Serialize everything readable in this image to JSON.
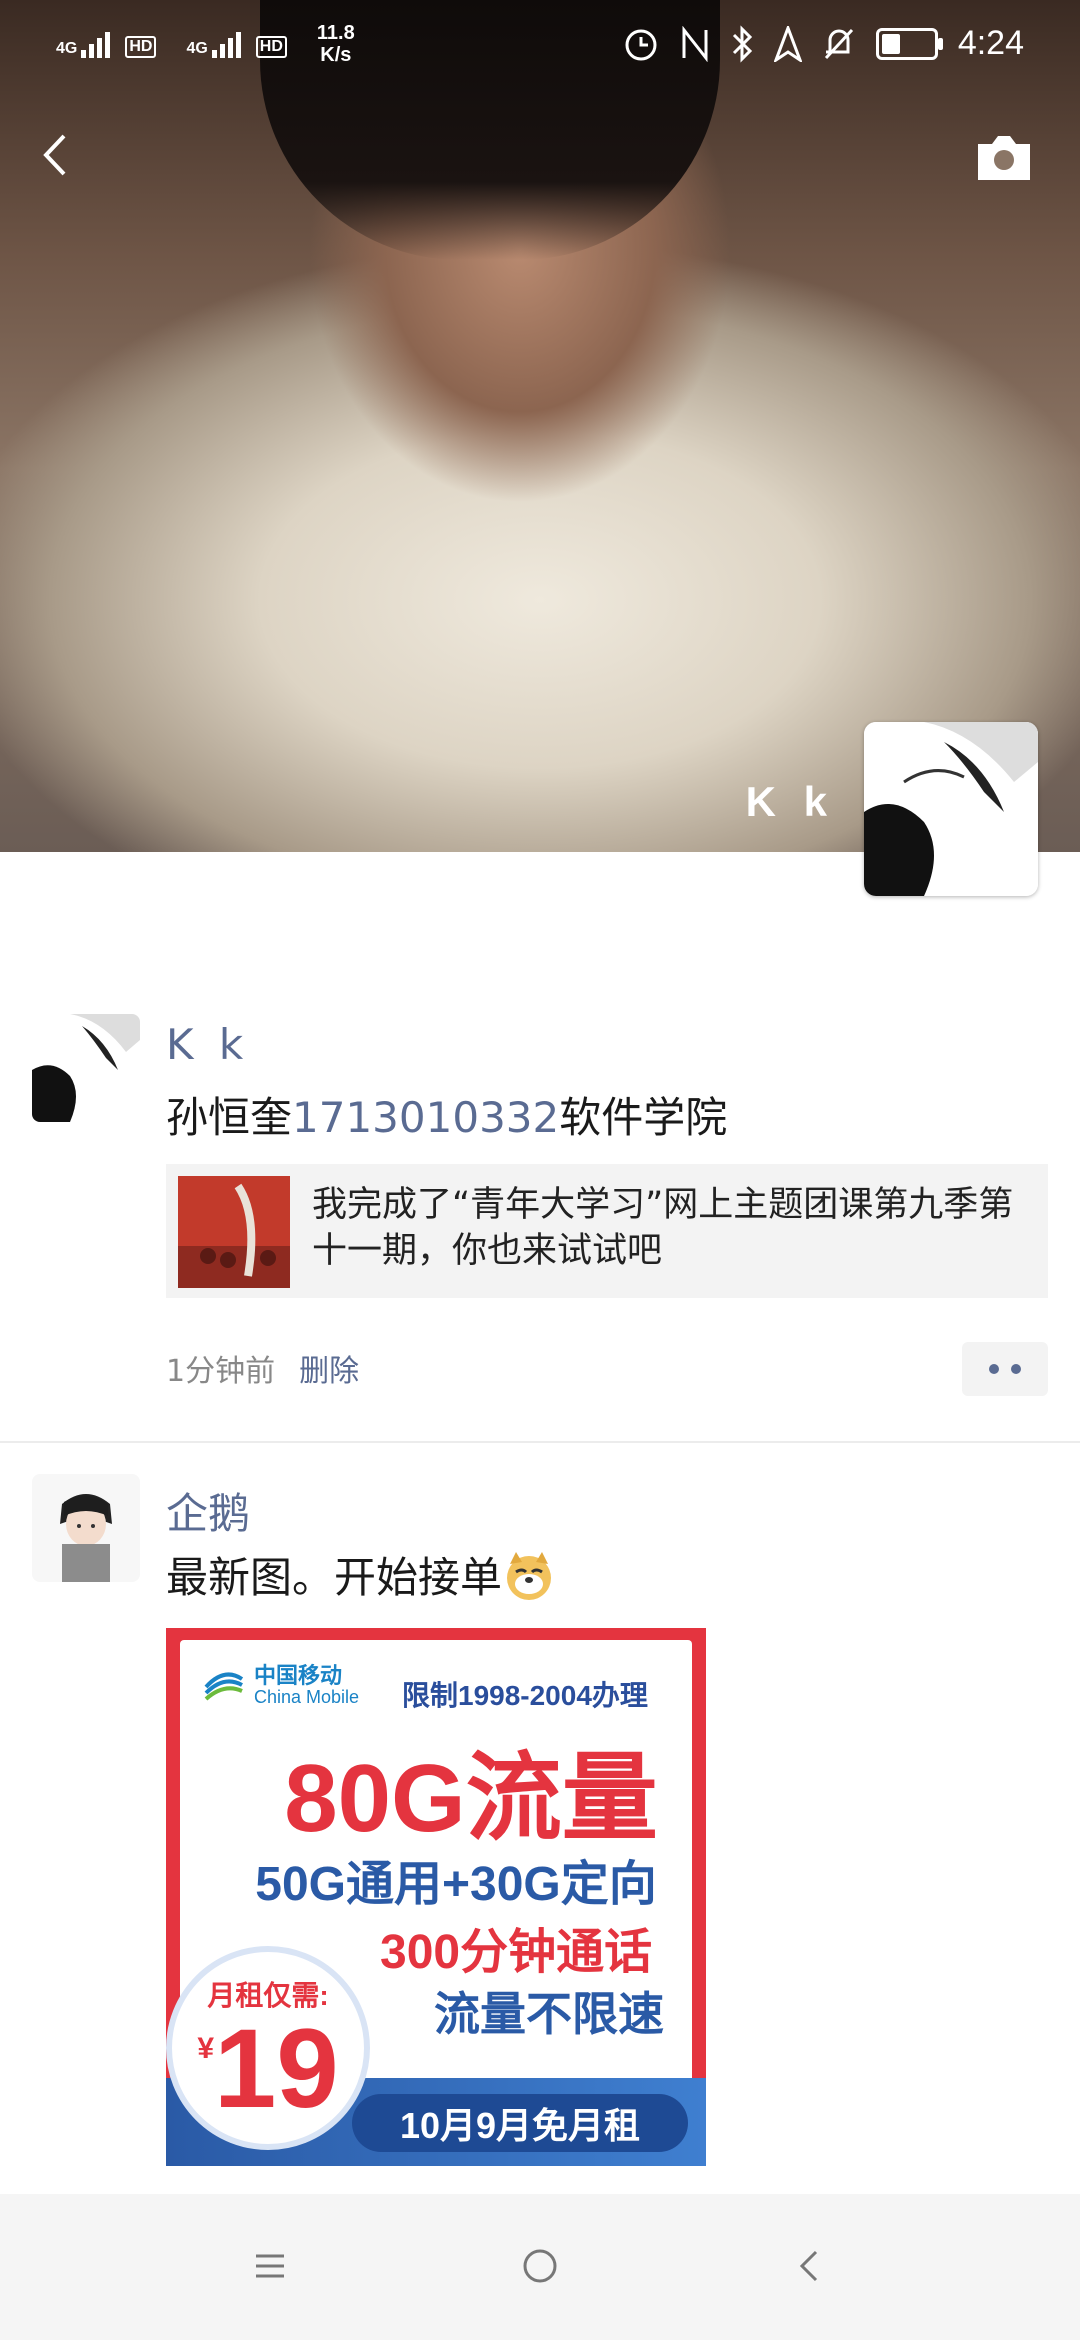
{
  "status_bar": {
    "network1": "4G",
    "hd1": "HD",
    "network2": "4G",
    "hd2": "HD",
    "speed_value": "11.8",
    "speed_unit": "K/s",
    "time": "4:24",
    "icons": [
      "alarm-icon",
      "nfc-icon",
      "bluetooth-icon",
      "location-icon",
      "mute-icon",
      "battery-icon"
    ]
  },
  "cover": {
    "name": "K k",
    "icons": [
      "back-arrow-icon",
      "camera-icon"
    ]
  },
  "posts": [
    {
      "name": "K k",
      "text_prefix": "孙恒奎",
      "text_number": "1713010332",
      "text_suffix": "软件学院",
      "share_title": "我完成了“青年大学习”网上主题团课第九季第十一期，你也来试试吧",
      "time_ago": "1分钟前",
      "delete_label": "删除"
    },
    {
      "name": "企鹅",
      "text": "最新图。开始接单",
      "ad": {
        "logo_zh": "中国移动",
        "logo_en": "China Mobile",
        "limit": "限制1998-2004办理",
        "headline": "80G流量",
        "line2": "50G通用+30G定向",
        "line3": "300分钟通话",
        "line4": "流量不限速",
        "price_label": "月租仅需:",
        "currency": "¥",
        "price": "19",
        "band": "10月9月免月租"
      }
    }
  ],
  "nav": {
    "icons": [
      "menu-icon",
      "home-icon",
      "back-icon"
    ]
  }
}
